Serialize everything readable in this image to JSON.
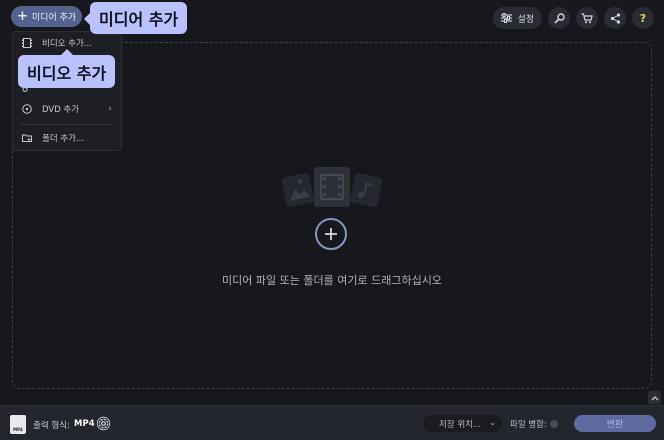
{
  "toolbar": {
    "add_media_label": "미디어 추가",
    "settings_label": "설정"
  },
  "tooltips": {
    "add_media": "미디어 추가",
    "add_video": "비디오 추가"
  },
  "dropdown": {
    "items": [
      {
        "label": "비디오 추가...",
        "icon": "video-file-icon"
      },
      {
        "label": "",
        "icon": "audio-file-icon"
      },
      {
        "label": "DVD 추가",
        "icon": "dvd-icon",
        "submenu": true
      },
      {
        "label": "폴더 추가...",
        "icon": "folder-icon"
      }
    ]
  },
  "drop_area": {
    "hint": "미디어 파일 또는 폴더를 여기로 드래그하십시오"
  },
  "bottom_bar": {
    "format_icon_text": "MP4",
    "output_format_label": "출력 형식:",
    "output_format_value": "MP4",
    "save_location_label": "저장 위치...",
    "merge_files_label": "파일 병합:",
    "convert_label": "변환"
  },
  "colors": {
    "background": "#17181c",
    "accent": "#b9c2ff",
    "add_media_button": "#54638d",
    "convert_button": "#5d6aa1",
    "help_icon": "#f2c94c"
  }
}
